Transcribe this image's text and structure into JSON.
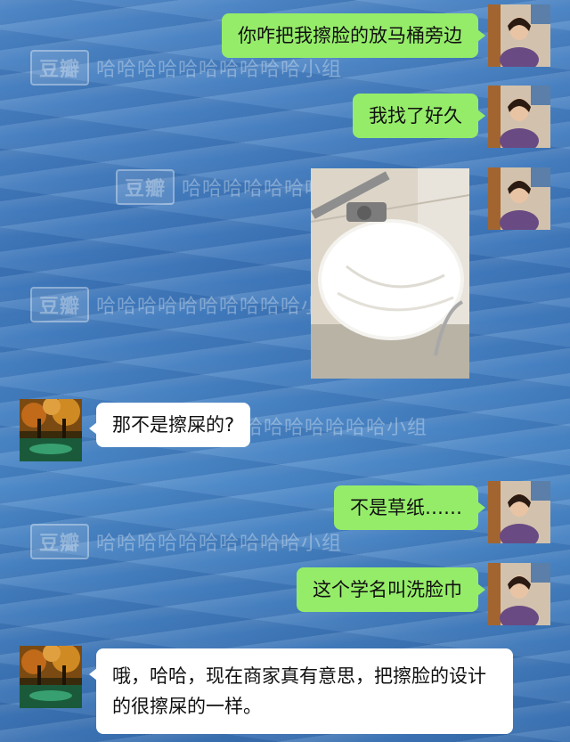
{
  "watermark": {
    "logo": "豆瓣",
    "text": "哈哈哈哈哈哈哈哈哈哈小组"
  },
  "messages": [
    {
      "side": "right",
      "text": "你咋把我擦脸的放马桶旁边"
    },
    {
      "side": "right",
      "text": "我找了好久"
    },
    {
      "side": "right",
      "type": "image",
      "image_icon": "toilet-paper-roll-photo"
    },
    {
      "side": "left",
      "text": "那不是擦屎的?"
    },
    {
      "side": "right",
      "text": "不是草纸……"
    },
    {
      "side": "right",
      "text": "这个学名叫洗脸巾"
    },
    {
      "side": "left",
      "text": "哦，哈哈，现在商家真有意思，把擦脸的设计的很擦屎的一样。"
    }
  ],
  "colors": {
    "sent_bubble": "#95ec69",
    "received_bubble": "#ffffff",
    "background": "#4a82c3"
  }
}
